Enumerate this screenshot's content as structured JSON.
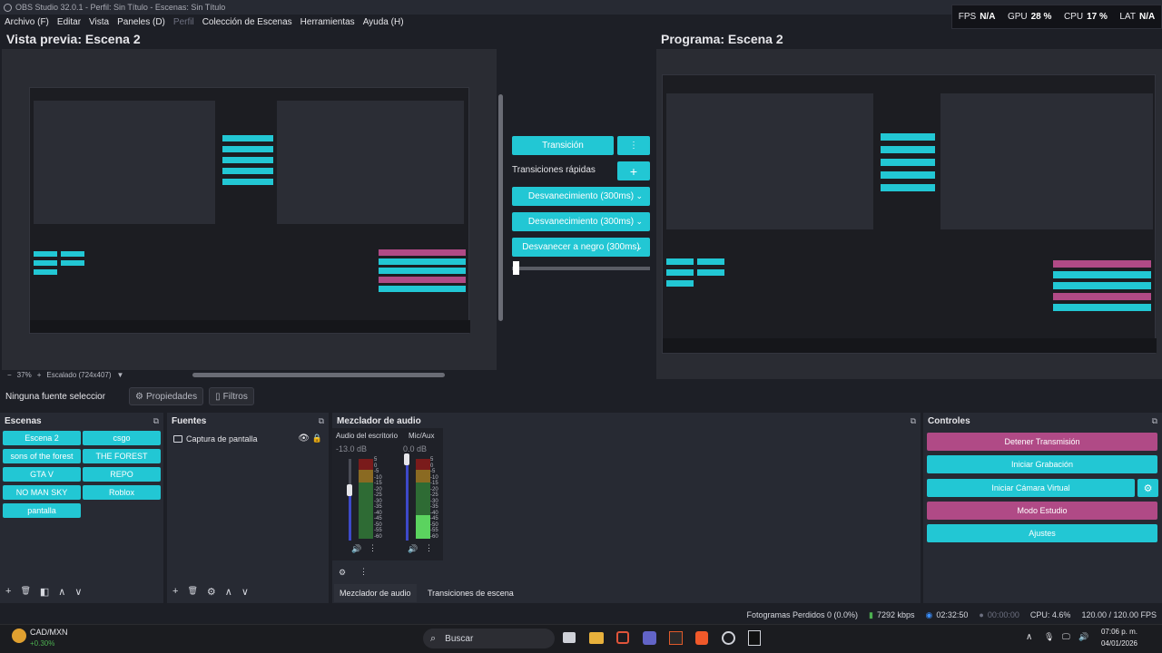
{
  "window": {
    "title": "OBS Studio 32.0.1 - Perfil: Sin Título - Escenas: Sin Título"
  },
  "menu": [
    "Archivo (F)",
    "Editar",
    "Vista",
    "Paneles (D)",
    "Perfil",
    "Colección de Escenas",
    "Herramientas",
    "Ayuda (H)"
  ],
  "stats": {
    "fps_label": "FPS",
    "fps_value": "N/A",
    "gpu_label": "GPU",
    "gpu_value": "28 %",
    "cpu_label": "CPU",
    "cpu_value": "17 %",
    "lat_label": "LAT",
    "lat_value": "N/A"
  },
  "preview": {
    "title": "Vista previa: Escena 2",
    "zoom_minus": "−",
    "zoom_value": "37%",
    "zoom_plus": "+",
    "scale_label": "Escalado (724x407)",
    "scale_arrow": "▼"
  },
  "program": {
    "title": "Programa: Escena 2"
  },
  "transitions": {
    "transition_button": "Transición",
    "menu_icon": "⋮",
    "quick_label": "Transiciones rápidas",
    "add_icon": "+",
    "chevron_icon": "⌄",
    "items": [
      "Desvanecimiento (300ms)",
      "Desvanecimiento (300ms)",
      "Desvanecer a negro (300ms)"
    ]
  },
  "source_toolbar": {
    "no_source": "Ninguna fuente seleccionada",
    "properties": "Propiedades",
    "filters": "Filtros",
    "gear_icon": "⚙",
    "filter_icon": "▯"
  },
  "docks": {
    "float_icon": "⧉",
    "scenes": {
      "title": "Escenas",
      "items": [
        "Escena 2",
        "csgo",
        "sons of the forest",
        "THE FOREST",
        "GTA V",
        "REPO",
        "NO MAN SKY",
        "Roblox",
        "pantalla"
      ]
    },
    "sources": {
      "title": "Fuentes",
      "items": [
        {
          "name": "Captura de pantalla"
        }
      ],
      "eye_icon": "👁",
      "lock_icon": "🔒"
    },
    "mixer": {
      "title": "Mezclador de audio",
      "channels": [
        {
          "name": "Audio del escritorio",
          "db": "-13.0 dB",
          "level": 0.62
        },
        {
          "name": "Mic/Aux",
          "db": "0.0 dB",
          "level": 1.0
        }
      ],
      "tick_labels": [
        "5",
        "0",
        "-5",
        "-10",
        "-15",
        "-20",
        "-25",
        "-30",
        "-35",
        "-40",
        "-45",
        "-50",
        "-55",
        "-60"
      ],
      "speaker_icon": "🔊",
      "menu_icon": "⋮",
      "gear_icon": "⚙",
      "tabs": [
        "Mezclador de audio",
        "Transiciones de escena"
      ]
    },
    "controls": {
      "title": "Controles",
      "buttons": [
        "Detener Transmisión",
        "Iniciar Grabación",
        "Iniciar Cámara Virtual",
        "Modo Estudio",
        "Ajustes"
      ],
      "gear_icon": "⚙",
      "colors": {
        "active": "#b04a86",
        "normal": "#22c7d4"
      }
    },
    "tools": {
      "add": "+",
      "remove": "🗑",
      "filter": "◧",
      "up": "∧",
      "down": "∨",
      "gear": "⚙"
    }
  },
  "status": {
    "dropped": "Fotogramas Perdidos 0 (0.0%)",
    "bitrate": "7292 kbps",
    "stream_time": "02:32:50",
    "rec_time": "00:00:00",
    "cpu": "CPU: 4.6%",
    "fps": "120.00 / 120.00 FPS",
    "signal_icon": "▮",
    "stream_icon": "◉",
    "rec_icon": "●"
  },
  "taskbar": {
    "stock_name": "CAD/MXN",
    "stock_change": "+0.30%",
    "search_placeholder": "Buscar",
    "search_icon": "⌕",
    "time": "07:06 p. m.",
    "date": "04/01/2026",
    "tray_icons": [
      "∧",
      "🎙",
      "🖵",
      "🔊"
    ]
  },
  "colors": {
    "accent": "#22c7d4",
    "active": "#b04a86",
    "bg": "#1d1f26",
    "panel": "#272a33"
  }
}
